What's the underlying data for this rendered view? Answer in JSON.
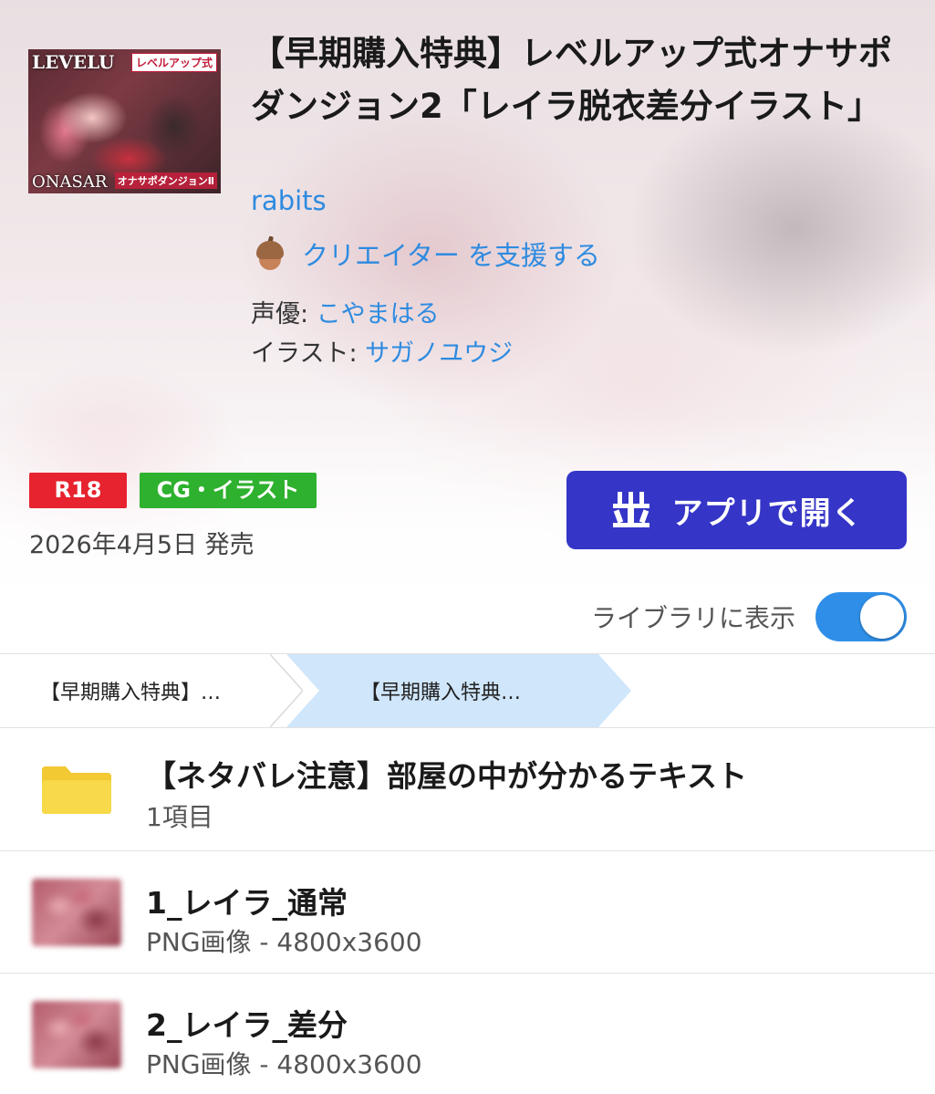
{
  "work": {
    "title": "【早期購入特典】レベルアップ式オナサポダンジョン2「レイラ脱衣差分イラスト」",
    "circle": "rabits",
    "support_label": "クリエイター を支援する",
    "voice_label": "声優: ",
    "voice_name": "こやまはる",
    "illust_label": "イラスト: ",
    "illust_name": "サガノユウジ",
    "rating_badge": "R18",
    "genre_badge": "CG・イラスト",
    "release": "2026年4月5日 発売",
    "open_button": "アプリで開く",
    "library_label": "ライブラリに表示",
    "library_toggle_on": true
  },
  "cover": {
    "title_text": "LEVELU",
    "badge_text": "レベルアップ式",
    "bottom_left": "ONASAR",
    "bottom_right": "オナサポダンジョンⅡ"
  },
  "breadcrumb": {
    "items": [
      "【早期購入特典】…",
      "【早期購入特典…"
    ]
  },
  "files": [
    {
      "type": "folder",
      "name": "【ネタバレ注意】部屋の中が分かるテキスト",
      "meta": "1項目"
    },
    {
      "type": "image",
      "name": "1_レイラ_通常",
      "meta": "PNG画像 - 4800x3600"
    },
    {
      "type": "image",
      "name": "2_レイラ_差分",
      "meta": "PNG画像 - 4800x3600"
    }
  ],
  "colors": {
    "accent_blue": "#3535c8",
    "link_blue": "#2e8be0",
    "r18_red": "#e6232e",
    "genre_green": "#2eb12e",
    "toggle_blue": "#2f8fe8",
    "folder_yellow": "#f7d94a"
  },
  "icons": [
    "acorn-icon",
    "app-icon",
    "folder-icon"
  ]
}
